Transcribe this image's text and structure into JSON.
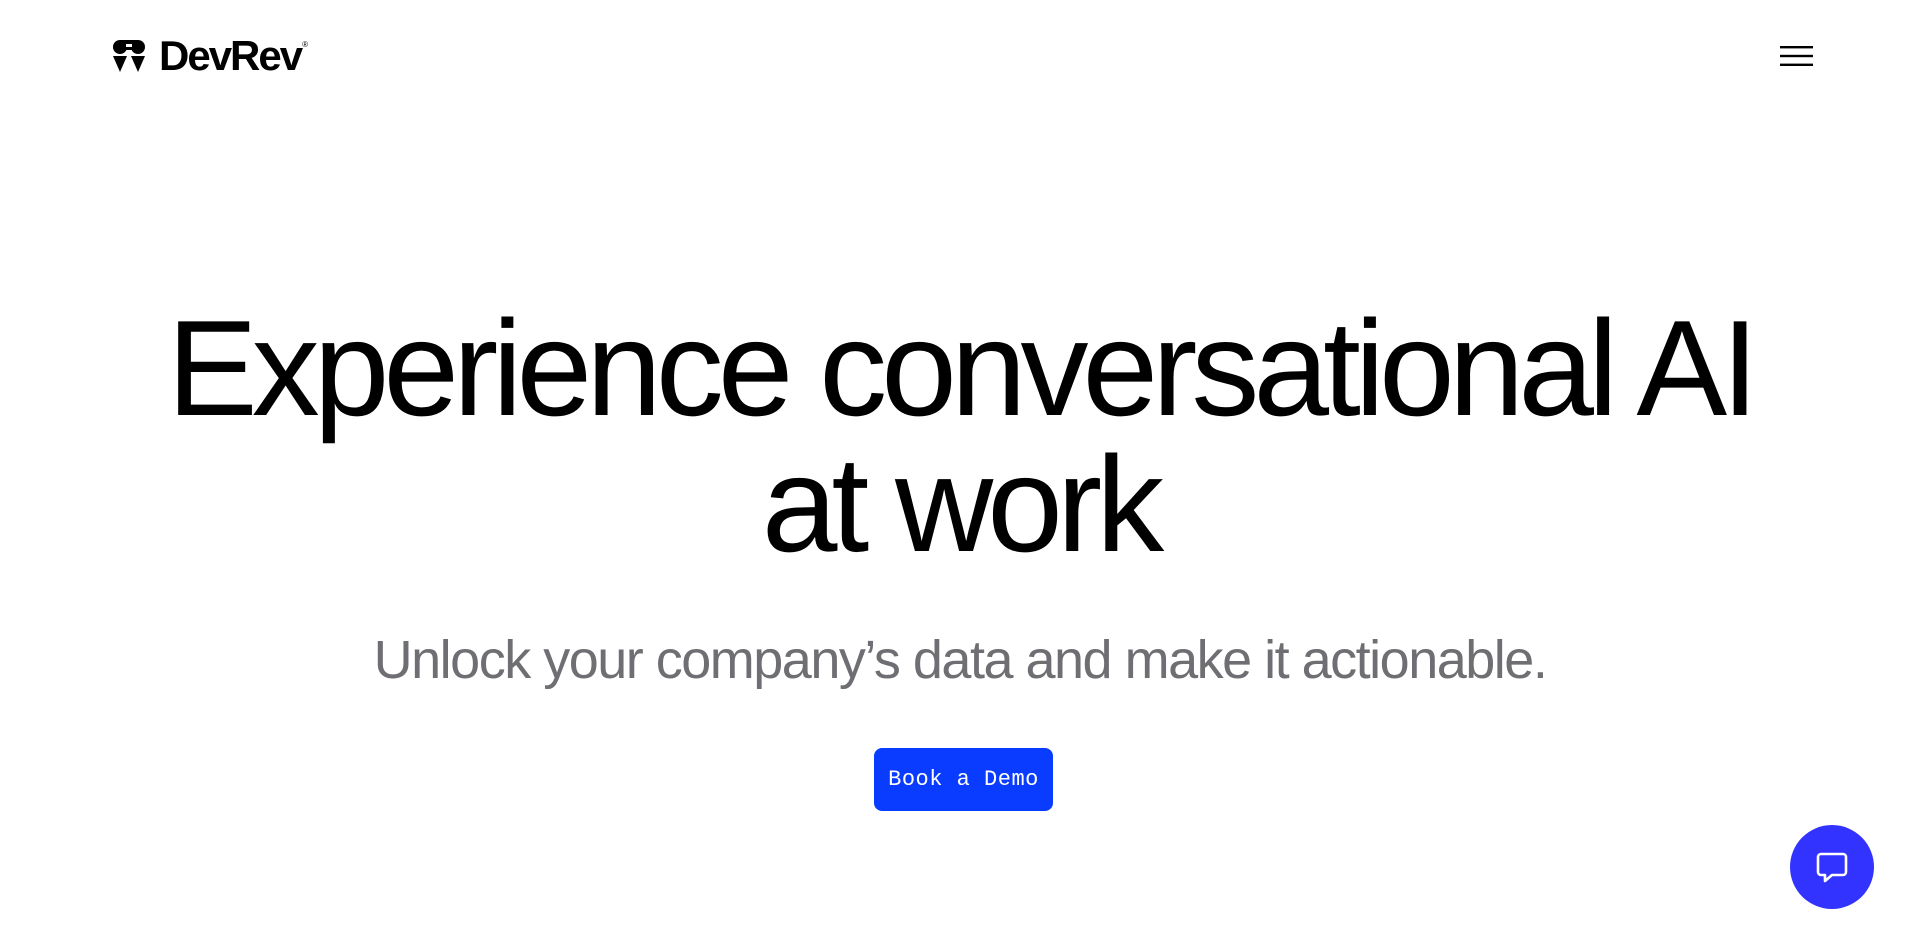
{
  "header": {
    "logo_text": "DevRev",
    "logo_reg": "®",
    "menu_icon": "hamburger-menu-icon"
  },
  "hero": {
    "title_line1": "Experience conversational AI",
    "title_line2": "at work",
    "subtitle": "Unlock your company’s data and make it actionable.",
    "cta_label": "Book a Demo"
  },
  "chat_widget": {
    "icon": "chat-bubble-icon"
  },
  "colors": {
    "cta_background": "#0a3cff",
    "chat_background": "#3333ff",
    "subtitle_text": "#6e6e73"
  }
}
